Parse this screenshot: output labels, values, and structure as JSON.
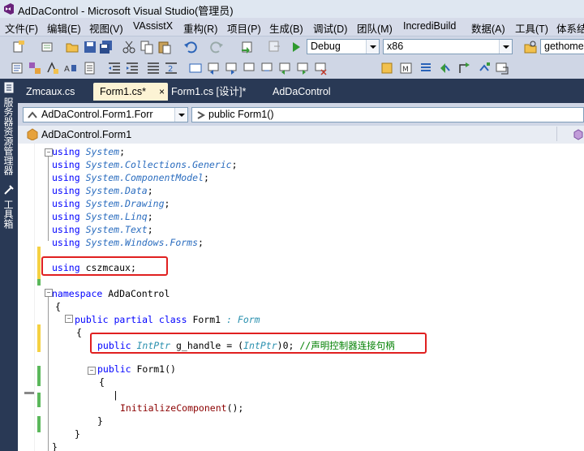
{
  "window": {
    "title": "AdDaControl - Microsoft Visual Studio(管理员)"
  },
  "menu": [
    {
      "label": "文件(F)"
    },
    {
      "label": "编辑(E)"
    },
    {
      "label": "视图(V)"
    },
    {
      "label": "VAssistX"
    },
    {
      "label": "重构(R)"
    },
    {
      "label": "项目(P)"
    },
    {
      "label": "生成(B)"
    },
    {
      "label": "调试(D)"
    },
    {
      "label": "团队(M)"
    },
    {
      "label": "IncrediBuild"
    },
    {
      "label": "数据(A)"
    },
    {
      "label": "工具(T)"
    },
    {
      "label": "体系结"
    }
  ],
  "toolbar": {
    "config": "Debug",
    "platform": "x86",
    "find_text": "gethome"
  },
  "side_panels": {
    "server_explorer": "服务器资源管理器",
    "toolbox": "工具箱"
  },
  "tabs": [
    {
      "label": "Zmcaux.cs"
    },
    {
      "label": "Form1.cs*",
      "close": "×"
    },
    {
      "label": "Form1.cs [设计]*"
    },
    {
      "label": "AdDaControl"
    }
  ],
  "navbar": {
    "type_combo": "AdDaControl.Form1.Forr",
    "member_combo": "public Form1()"
  },
  "classbar": {
    "label": "AdDaControl.Form1"
  },
  "code": {
    "l1": [
      "using",
      "System",
      ";"
    ],
    "l2": [
      "using",
      "System.Collections.Generic",
      ";"
    ],
    "l3": [
      "using",
      "System.ComponentModel",
      ";"
    ],
    "l4": [
      "using",
      "System.Data",
      ";"
    ],
    "l5": [
      "using",
      "System.Drawing",
      ";"
    ],
    "l6": [
      "using",
      "System.Linq",
      ";"
    ],
    "l7": [
      "using",
      "System.Text",
      ";"
    ],
    "l8": [
      "using",
      "System.Windows.Forms",
      ";"
    ],
    "l9": [
      "using",
      "cszmcaux",
      ";"
    ],
    "l10": [
      "namespace",
      "AdDaControl"
    ],
    "l11": "{",
    "l12": [
      "public",
      "partial",
      "class",
      "Form1",
      ":",
      "Form"
    ],
    "l13": "{",
    "l14": [
      "public",
      "IntPtr",
      "g_handle =",
      "(",
      "IntPtr",
      ")0;",
      "//声明控制器连接句柄"
    ],
    "l15": [
      "public",
      "Form1",
      "()"
    ],
    "l16": "{",
    "l17": "|",
    "l18": [
      "InitializeComponent",
      "();"
    ],
    "l19": "}",
    "l20": "}",
    "l21": "}"
  }
}
